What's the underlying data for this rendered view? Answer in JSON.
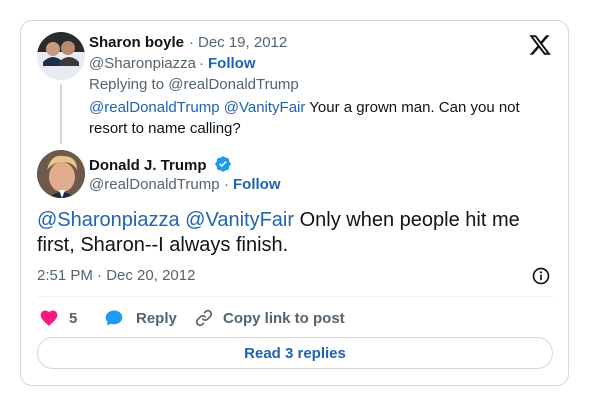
{
  "colors": {
    "link": "#1d64b3",
    "muted": "#536471",
    "text": "#0f1419",
    "like": "#f91880",
    "verified": "#1d9bf0",
    "border": "#cfd9de"
  },
  "parent": {
    "name": "Sharon boyle",
    "date_sep": "·",
    "date": "Dec 19, 2012",
    "handle": "@Sharonpiazza",
    "follow_sep": "·",
    "follow": "Follow",
    "replying_prefix": "Replying to",
    "replying_to": "@realDonaldTrump",
    "mention1": "@realDonaldTrump",
    "mention2": "@VanityFair",
    "text": "Your a grown man.  Can you not resort to name calling?"
  },
  "tweet": {
    "name": "Donald J. Trump",
    "verified_icon": "verified-badge-icon",
    "handle": "@realDonaldTrump",
    "follow_sep": "·",
    "follow": "Follow",
    "mention1": "@Sharonpiazza",
    "mention2": "@VanityFair",
    "text": "Only when people hit me first, Sharon--I always finish.",
    "time": "2:51 PM",
    "time_sep": "·",
    "date": "Dec 20, 2012"
  },
  "actions": {
    "likes": "5",
    "reply": "Reply",
    "copy_link": "Copy link to post"
  },
  "read_replies": "Read 3 replies",
  "icons": [
    "x-logo-icon",
    "info-icon",
    "heart-icon",
    "reply-bubble-icon",
    "link-icon"
  ]
}
